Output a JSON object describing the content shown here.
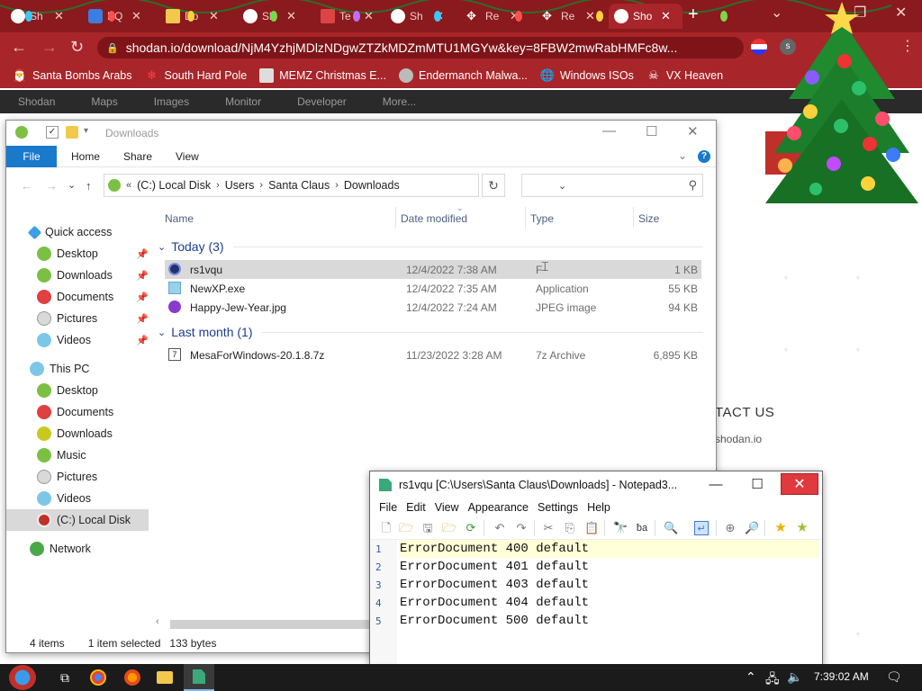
{
  "chrome": {
    "tabs": [
      {
        "label": "Sh"
      },
      {
        "label": "PQ"
      },
      {
        "label": "Do"
      },
      {
        "label": "Sh"
      },
      {
        "label": "Te"
      },
      {
        "label": "Sh"
      },
      {
        "label": "Re"
      },
      {
        "label": "Re"
      },
      {
        "label": "Sho"
      }
    ],
    "new_tab": "+",
    "url": "shodan.io/download/NjM4YzhjMDlzNDgwZTZkMDZmMTU1MGYw&key=8FBW2mwRabHMFc8w...",
    "bookmarks": [
      {
        "label": "Santa Bombs Arabs",
        "icon": "santa-icon"
      },
      {
        "label": "South Hard Pole",
        "icon": "snowflake-icon"
      },
      {
        "label": "MEMZ Christmas E...",
        "icon": "image-icon"
      },
      {
        "label": "Endermanch Malwa...",
        "icon": "raccoon-icon"
      },
      {
        "label": "Windows ISOs",
        "icon": "globe-icon"
      },
      {
        "label": "VX Heaven",
        "icon": "skull-icon"
      }
    ],
    "accent": "#a8252a"
  },
  "shodan": {
    "nav": [
      "Shodan",
      "Maps",
      "Images",
      "Monitor",
      "Developer",
      "More..."
    ],
    "contact": "TACT US",
    "contact_mail": "shodan.io"
  },
  "explorer": {
    "title": "Downloads",
    "ribbon": {
      "file": "File",
      "tabs": [
        "Home",
        "Share",
        "View"
      ],
      "help": "?"
    },
    "address": [
      "(C:) Local Disk",
      "Users",
      "Santa Claus",
      "Downloads"
    ],
    "address_prefix": "«",
    "nav": {
      "quick_access": "Quick access",
      "quick_items": [
        "Desktop",
        "Downloads",
        "Documents",
        "Pictures",
        "Videos"
      ],
      "this_pc": "This PC",
      "pc_items": [
        "Desktop",
        "Documents",
        "Downloads",
        "Music",
        "Pictures",
        "Videos",
        "(C:) Local Disk"
      ],
      "network": "Network"
    },
    "columns": {
      "name": "Name",
      "date": "Date modified",
      "type": "Type",
      "size": "Size"
    },
    "groups": [
      {
        "label": "Today (3)",
        "files": [
          {
            "name": "rs1vqu",
            "date": "12/4/2022 7:38 AM",
            "type": "F",
            "size": "1 KB",
            "selected": true
          },
          {
            "name": "NewXP.exe",
            "date": "12/4/2022 7:35 AM",
            "type": "Application",
            "size": "55 KB"
          },
          {
            "name": "Happy-Jew-Year.jpg",
            "date": "12/4/2022 7:24 AM",
            "type": "JPEG image",
            "size": "94 KB"
          }
        ]
      },
      {
        "label": "Last month (1)",
        "files": [
          {
            "name": "MesaForWindows-20.1.8.7z",
            "date": "11/23/2022 3:28 AM",
            "type": "7z Archive",
            "size": "6,895 KB"
          }
        ]
      }
    ],
    "status": {
      "items": "4 items",
      "selected": "1 item selected",
      "bytes": "133 bytes"
    }
  },
  "notepad": {
    "title": "rs1vqu [C:\\Users\\Santa Claus\\Downloads] - Notepad3...",
    "menu": [
      "File",
      "Edit",
      "View",
      "Appearance",
      "Settings",
      "Help"
    ],
    "lines": [
      {
        "n": "1",
        "text": "ErrorDocument 400 default"
      },
      {
        "n": "2",
        "text": "ErrorDocument 401 default"
      },
      {
        "n": "3",
        "text": "ErrorDocument 403 default"
      },
      {
        "n": "4",
        "text": "ErrorDocument 404 default"
      },
      {
        "n": "5",
        "text": "ErrorDocument 500 default"
      }
    ]
  },
  "taskbar": {
    "clock": "7:39:02 AM"
  }
}
